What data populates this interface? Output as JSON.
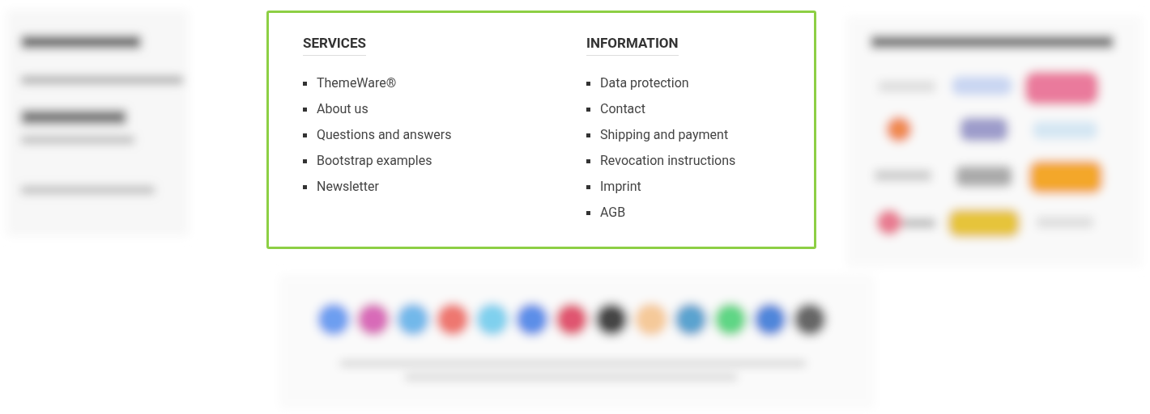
{
  "columns": [
    {
      "heading": "SERVICES",
      "links": [
        "ThemeWare®",
        "About us",
        "Questions and answers",
        "Bootstrap examples",
        "Newsletter"
      ]
    },
    {
      "heading": "INFORMATION",
      "links": [
        "Data protection",
        "Contact",
        "Shipping and payment",
        "Revocation instructions",
        "Imprint",
        "AGB"
      ]
    }
  ]
}
